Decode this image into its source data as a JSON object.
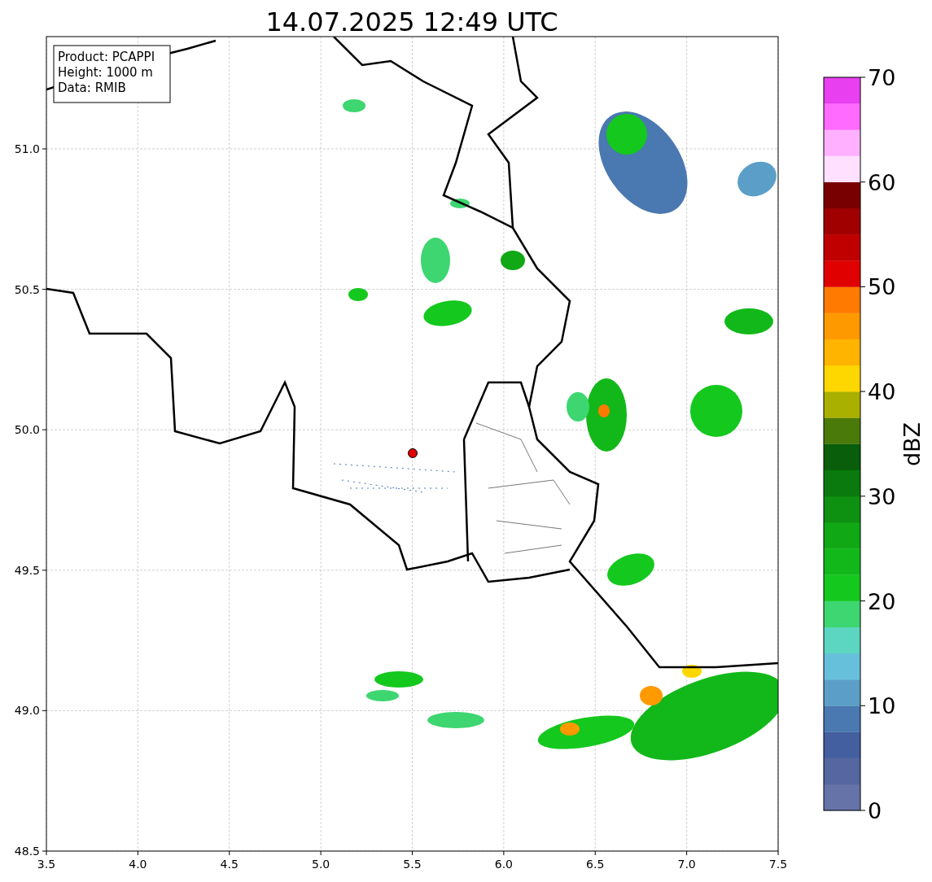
{
  "title": "14.07.2025 12:49 UTC",
  "info_box": [
    "Product: PCAPPI",
    "Height: 1000 m",
    "Data: RMIB"
  ],
  "map": {
    "x_ticks": [
      "3.5",
      "4.0",
      "4.5",
      "5.0",
      "5.5",
      "6.0",
      "6.5",
      "7.0",
      "7.5"
    ],
    "y_ticks": [
      "51.0",
      "50.5",
      "50.0",
      "49.5",
      "49.0",
      "48.5"
    ]
  },
  "colorbar": {
    "label": "dBZ",
    "ticks": [
      "70",
      "60",
      "50",
      "40",
      "30",
      "20",
      "10",
      "0"
    ],
    "bands": [
      {
        "color": "#6673a8"
      },
      {
        "color": "#5566a0"
      },
      {
        "color": "#435fa0"
      },
      {
        "color": "#4a78b0"
      },
      {
        "color": "#5b9fc8"
      },
      {
        "color": "#66c0dc"
      },
      {
        "color": "#5cd6c0"
      },
      {
        "color": "#3dd670"
      },
      {
        "color": "#14c81e"
      },
      {
        "color": "#12b81a"
      },
      {
        "color": "#10a814"
      },
      {
        "color": "#0e9010"
      },
      {
        "color": "#0b7a0e"
      },
      {
        "color": "#085e0a"
      },
      {
        "color": "#4a7a0a"
      },
      {
        "color": "#aab000"
      },
      {
        "color": "#ffd700"
      },
      {
        "color": "#ffb400"
      },
      {
        "color": "#ff9900"
      },
      {
        "color": "#ff7a00"
      },
      {
        "color": "#e00000"
      },
      {
        "color": "#c00000"
      },
      {
        "color": "#a00000"
      },
      {
        "color": "#780000"
      },
      {
        "color": "#ffe0ff"
      },
      {
        "color": "#ffb0ff"
      },
      {
        "color": "#ff6aff"
      },
      {
        "color": "#e840f0"
      }
    ]
  }
}
